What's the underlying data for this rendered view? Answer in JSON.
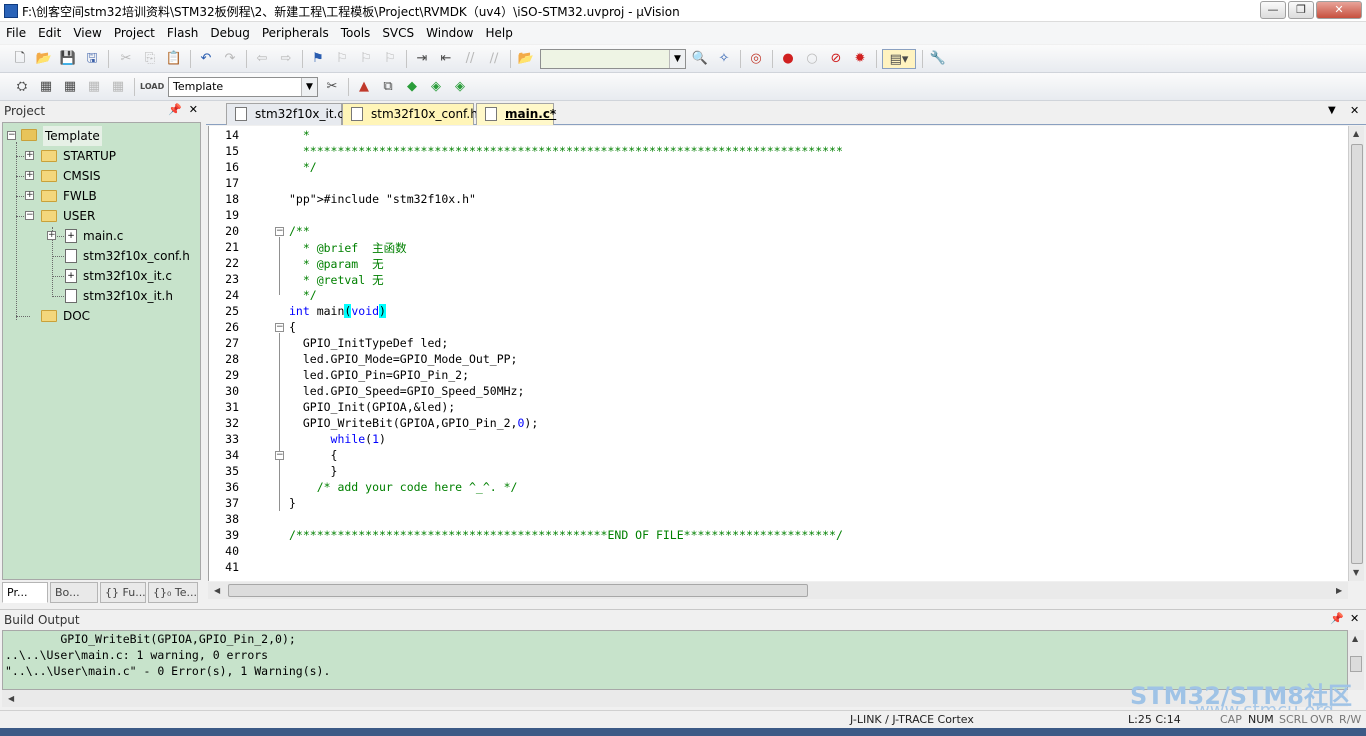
{
  "window": {
    "title": "F:\\创客空间stm32培训资料\\STM32板例程\\2、新建工程\\工程模板\\Project\\RVMDK（uv4）\\iSO-STM32.uvproj - µVision",
    "minimize": "—",
    "maximize": "❐",
    "close": "✕"
  },
  "menu": [
    "File",
    "Edit",
    "View",
    "Project",
    "Flash",
    "Debug",
    "Peripherals",
    "Tools",
    "SVCS",
    "Window",
    "Help"
  ],
  "toolbar2": {
    "target_select": "Template"
  },
  "project_panel": {
    "header": "Project",
    "tree": {
      "root": "Template",
      "groups": [
        "STARTUP",
        "CMSIS",
        "FWLB",
        "USER",
        "DOC"
      ],
      "user_files": [
        "main.c",
        "stm32f10x_conf.h",
        "stm32f10x_it.c",
        "stm32f10x_it.h"
      ]
    },
    "tabs": [
      "Pr...",
      "Bo...",
      "{} Fu...",
      "{}₀ Te..."
    ]
  },
  "editor": {
    "tabs": [
      "stm32f10x_it.c",
      "stm32f10x_conf.h",
      "main.c*"
    ],
    "lines": [
      {
        "n": "14",
        "text": "  *"
      },
      {
        "n": "15",
        "text": "  ******************************************************************************"
      },
      {
        "n": "16",
        "text": "  */"
      },
      {
        "n": "17",
        "text": ""
      },
      {
        "n": "18",
        "text": "#include \"stm32f10x.h\""
      },
      {
        "n": "19",
        "text": ""
      },
      {
        "n": "20",
        "text": "/**"
      },
      {
        "n": "21",
        "text": "  * @brief  主函数"
      },
      {
        "n": "22",
        "text": "  * @param  无"
      },
      {
        "n": "23",
        "text": "  * @retval 无"
      },
      {
        "n": "24",
        "text": "  */"
      },
      {
        "n": "25",
        "text": "int main(void)"
      },
      {
        "n": "26",
        "text": "{"
      },
      {
        "n": "27",
        "text": "  GPIO_InitTypeDef led;"
      },
      {
        "n": "28",
        "text": "  led.GPIO_Mode=GPIO_Mode_Out_PP;"
      },
      {
        "n": "29",
        "text": "  led.GPIO_Pin=GPIO_Pin_2;"
      },
      {
        "n": "30",
        "text": "  led.GPIO_Speed=GPIO_Speed_50MHz;"
      },
      {
        "n": "31",
        "text": "  GPIO_Init(GPIOA,&led);"
      },
      {
        "n": "32",
        "text": "  GPIO_WriteBit(GPIOA,GPIO_Pin_2,0);"
      },
      {
        "n": "33",
        "text": "      while(1)"
      },
      {
        "n": "34",
        "text": "      {"
      },
      {
        "n": "35",
        "text": "      }"
      },
      {
        "n": "36",
        "text": "    /* add your code here ^_^. */"
      },
      {
        "n": "37",
        "text": "}"
      },
      {
        "n": "38",
        "text": ""
      },
      {
        "n": "39",
        "text": "/*********************************************END OF FILE**********************/"
      },
      {
        "n": "40",
        "text": ""
      },
      {
        "n": "41",
        "text": ""
      }
    ]
  },
  "build_output": {
    "header": "Build Output",
    "lines": [
      "        GPIO_WriteBit(GPIOA,GPIO_Pin_2,0);",
      "..\\..\\User\\main.c: 1 warning, 0 errors",
      "\"..\\..\\User\\main.c\" - 0 Error(s), 1 Warning(s)."
    ]
  },
  "status": {
    "debugger": "J-LINK / J-TRACE Cortex",
    "position": "L:25 C:14",
    "caps": "CAP",
    "num": "NUM",
    "scrl": "SCRL",
    "ovr": "OVR",
    "rw": "R/W"
  },
  "watermark": {
    "brand": "STM32/STM8社区",
    "url": "www.stmcu.org"
  },
  "colors": {
    "panel_green": "#c7e3cb",
    "comment": "#008000",
    "keyword": "#0000ff",
    "string": "#800080",
    "brace_highlight": "#00ffff"
  }
}
